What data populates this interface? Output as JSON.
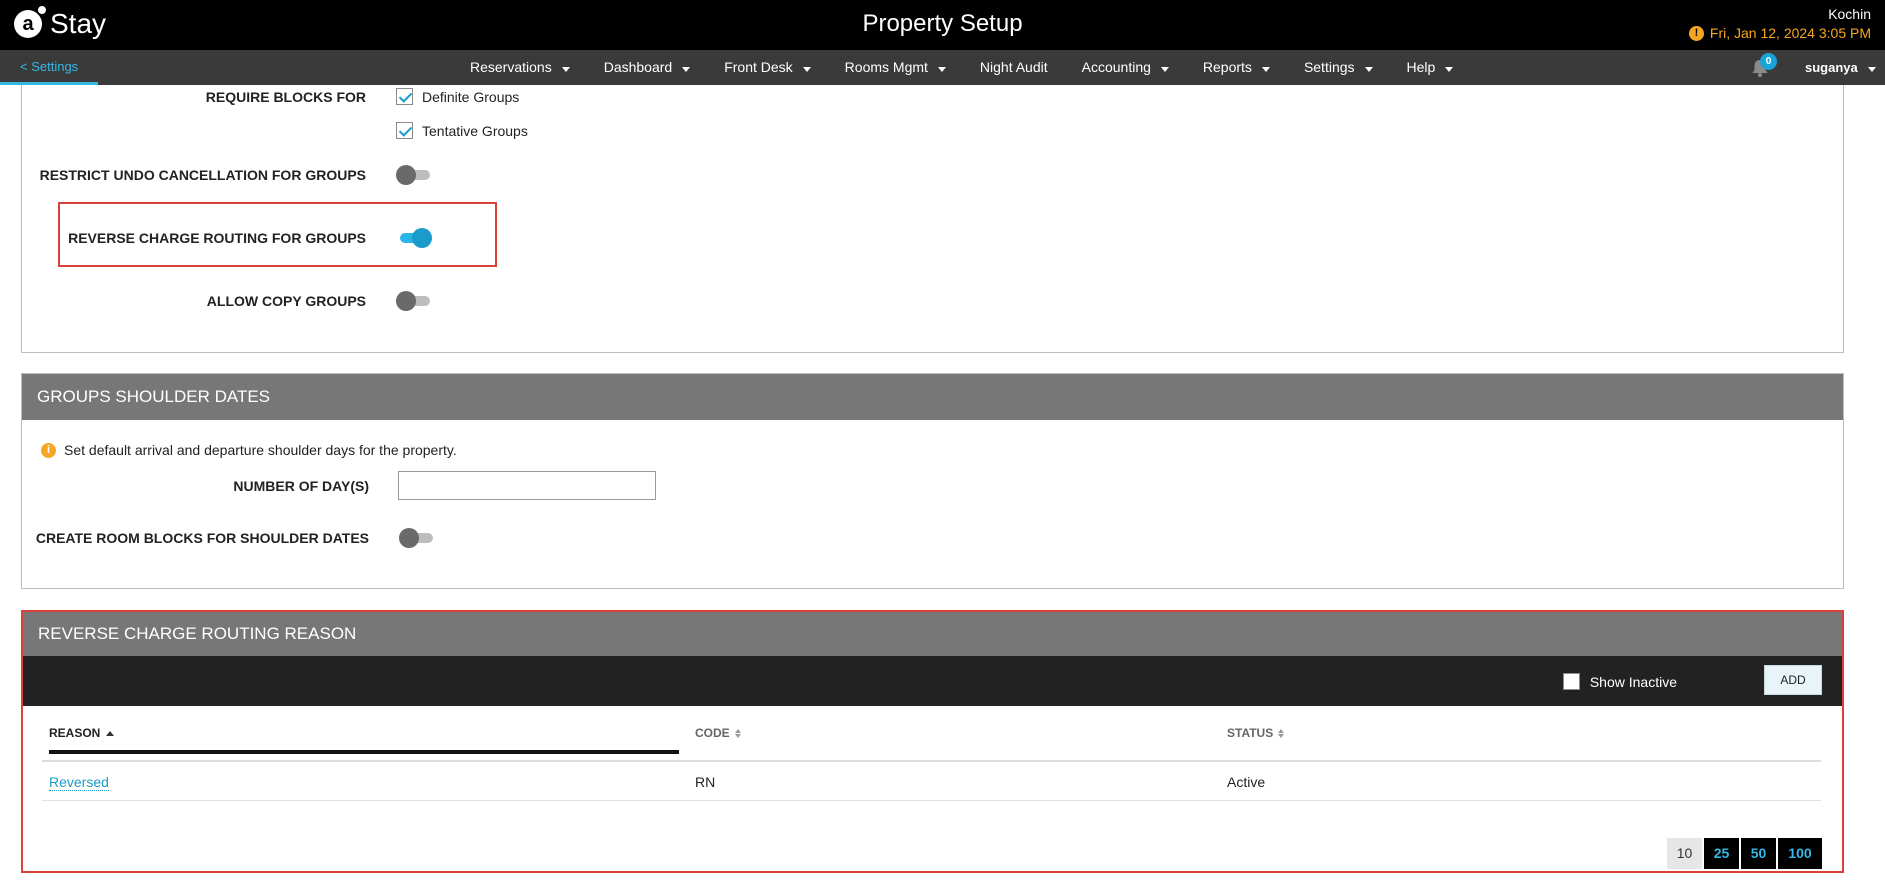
{
  "header": {
    "logo_text": "Stay",
    "title": "Property Setup",
    "location": "Kochin",
    "datetime": "Fri, Jan 12, 2024 3:05 PM",
    "warning_icon": "exclamation-circle-icon",
    "datetime_color": "#f5a623"
  },
  "nav": {
    "back_label": "< Settings",
    "items": [
      {
        "label": "Reservations",
        "dropdown": true
      },
      {
        "label": "Dashboard",
        "dropdown": true
      },
      {
        "label": "Front Desk",
        "dropdown": true
      },
      {
        "label": "Rooms Mgmt",
        "dropdown": true
      },
      {
        "label": "Night Audit",
        "dropdown": false
      },
      {
        "label": "Accounting",
        "dropdown": true
      },
      {
        "label": "Reports",
        "dropdown": true
      },
      {
        "label": "Settings",
        "dropdown": true
      },
      {
        "label": "Help",
        "dropdown": true
      }
    ],
    "notification_count": "0",
    "user_name": "suganya",
    "accent_color": "#35b8e6"
  },
  "groups_settings": {
    "require_blocks_label": "REQUIRE BLOCKS FOR",
    "definite_groups_label": "Definite Groups",
    "definite_groups_checked": true,
    "tentative_groups_label": "Tentative Groups",
    "tentative_groups_checked": true,
    "restrict_undo_label": "RESTRICT UNDO CANCELLATION FOR GROUPS",
    "restrict_undo_on": false,
    "reverse_charge_label": "REVERSE CHARGE ROUTING FOR GROUPS",
    "reverse_charge_on": true,
    "allow_copy_label": "ALLOW COPY GROUPS",
    "allow_copy_on": false
  },
  "shoulder_dates": {
    "title": "GROUPS SHOULDER DATES",
    "info_text": "Set default arrival and departure shoulder days for the property.",
    "number_of_days_label": "NUMBER OF DAY(S)",
    "number_of_days_value": "",
    "create_room_blocks_label": "CREATE ROOM BLOCKS FOR SHOULDER DATES",
    "create_room_blocks_on": false
  },
  "routing_reason": {
    "title": "REVERSE CHARGE ROUTING REASON",
    "show_inactive_label": "Show Inactive",
    "show_inactive_checked": false,
    "add_label": "ADD",
    "columns": [
      "REASON",
      "CODE",
      "STATUS"
    ],
    "rows": [
      {
        "reason": "Reversed",
        "code": "RN",
        "status": "Active"
      }
    ],
    "page_sizes": [
      "10",
      "25",
      "50",
      "100"
    ],
    "current_page_size": "10"
  },
  "highlight_color": "#d9423b"
}
